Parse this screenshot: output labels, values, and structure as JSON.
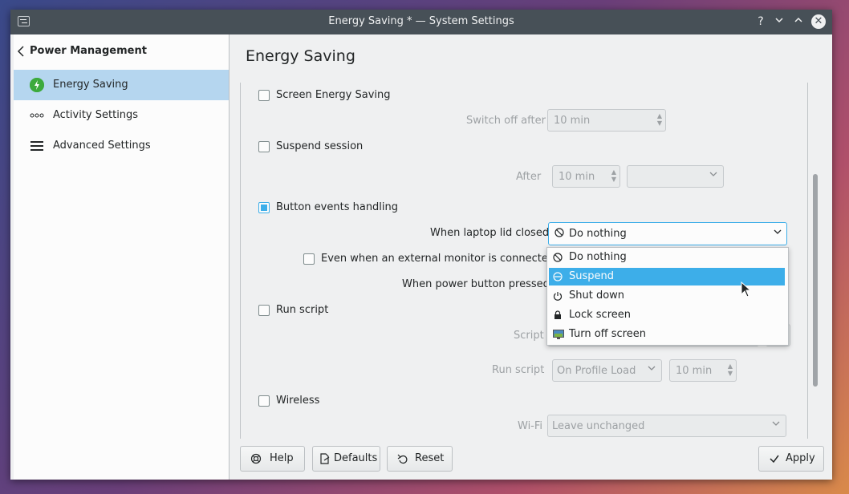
{
  "window": {
    "title": "Energy Saving * — System Settings",
    "buttons": {
      "help": "?",
      "minimize": "⌄",
      "maximize": "⌃",
      "close": "✕"
    }
  },
  "sidebar": {
    "header": "Power Management",
    "items": [
      {
        "label": "Energy Saving",
        "icon": "energy-icon",
        "active": true
      },
      {
        "label": "Activity Settings",
        "icon": "dots-icon",
        "active": false
      },
      {
        "label": "Advanced Settings",
        "icon": "hamburger-icon",
        "active": false
      }
    ]
  },
  "page": {
    "title": "Energy Saving"
  },
  "sections": {
    "screen_energy": {
      "label": "Screen Energy Saving",
      "checked": false,
      "switch_off_label": "Switch off after",
      "switch_off_value": "10 min"
    },
    "suspend": {
      "label": "Suspend session",
      "checked": false,
      "after_label": "After",
      "after_value": "10 min",
      "action_value": ""
    },
    "button_events": {
      "label": "Button events handling",
      "checked": true,
      "lid_label": "When laptop lid closed",
      "lid_value": "Do nothing",
      "external_monitor_label": "Even when an external monitor is connected",
      "external_monitor_checked": false,
      "power_button_label": "When power button pressed"
    },
    "run_script": {
      "label": "Run script",
      "checked": false,
      "script_label": "Script",
      "run_label": "Run script",
      "run_value": "On Profile Load",
      "time_value": "10 min"
    },
    "wireless": {
      "label": "Wireless",
      "checked": false,
      "wifi_label": "Wi-Fi",
      "wifi_value": "Leave unchanged"
    }
  },
  "dropdown": {
    "options": [
      {
        "label": "Do nothing",
        "icon": "do-nothing-icon",
        "highlighted": false
      },
      {
        "label": "Suspend",
        "icon": "suspend-icon",
        "highlighted": true
      },
      {
        "label": "Shut down",
        "icon": "shutdown-icon",
        "highlighted": false
      },
      {
        "label": "Lock screen",
        "icon": "lock-icon",
        "highlighted": false
      },
      {
        "label": "Turn off screen",
        "icon": "screen-icon",
        "highlighted": false
      }
    ]
  },
  "footer": {
    "help": "Help",
    "defaults": "Defaults",
    "reset": "Reset",
    "apply": "Apply"
  },
  "colors": {
    "accent": "#3daee9",
    "selection": "#b5d6ef",
    "titlebar": "#475057"
  }
}
